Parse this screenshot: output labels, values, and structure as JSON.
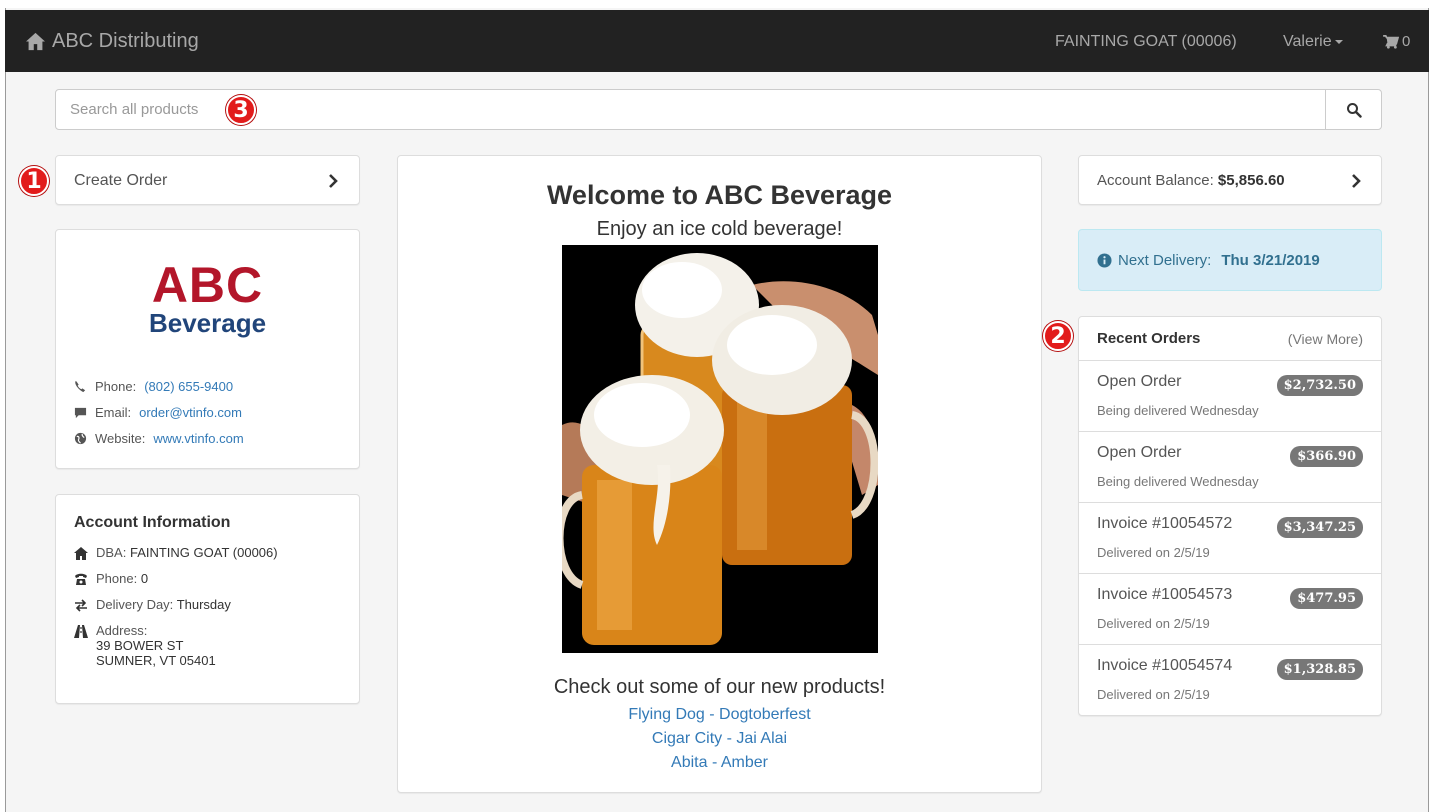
{
  "navbar": {
    "brand": "ABC Distributing",
    "account": "FAINTING GOAT (00006)",
    "user": "Valerie",
    "cart_count": "0"
  },
  "search": {
    "placeholder": "Search all products"
  },
  "callouts": {
    "one": "1",
    "two": "2",
    "three": "3"
  },
  "left": {
    "create_order": "Create Order",
    "logo": {
      "line1": "ABC",
      "line2": "Beverage"
    },
    "contact": {
      "phone_label": "Phone:",
      "phone": "(802) 655-9400",
      "email_label": "Email:",
      "email": "order@vtinfo.com",
      "website_label": "Website:",
      "website": "www.vtinfo.com"
    },
    "account_info": {
      "title": "Account Information",
      "dba_label": "DBA:",
      "dba": "FAINTING GOAT (00006)",
      "phone_label": "Phone:",
      "phone": "0",
      "delivery_label": "Delivery Day:",
      "delivery": "Thursday",
      "address_label": "Address:",
      "address_line1": "39 BOWER ST",
      "address_line2": "SUMNER, VT 05401"
    }
  },
  "center": {
    "welcome": "Welcome to ABC Beverage",
    "tagline": "Enjoy an ice cold beverage!",
    "new_products_heading": "Check out some of our new products!",
    "products": [
      "Flying Dog - Dogtoberfest",
      "Cigar City - Jai Alai",
      "Abita - Amber"
    ]
  },
  "right": {
    "balance_label": "Account Balance:",
    "balance": "$5,856.60",
    "next_delivery_label": "Next Delivery:",
    "next_delivery": "Thu 3/21/2019",
    "recent_orders": {
      "title": "Recent Orders",
      "view_more": "(View More)",
      "items": [
        {
          "name": "Open Order",
          "status": "Being delivered Wednesday",
          "amount": "$2,732.50"
        },
        {
          "name": "Open Order",
          "status": "Being delivered Wednesday",
          "amount": "$366.90"
        },
        {
          "name": "Invoice #10054572",
          "status": "Delivered on 2/5/19",
          "amount": "$3,347.25"
        },
        {
          "name": "Invoice #10054573",
          "status": "Delivered on 2/5/19",
          "amount": "$477.95"
        },
        {
          "name": "Invoice #10054574",
          "status": "Delivered on 2/5/19",
          "amount": "$1,328.85"
        }
      ]
    }
  },
  "colors": {
    "navbar_bg": "#222222",
    "link": "#337ab7",
    "callout": "#e21b1b",
    "alert_info_bg": "#d9edf7",
    "badge": "#777777",
    "logo_red": "#b3162a",
    "logo_blue": "#21457a"
  }
}
